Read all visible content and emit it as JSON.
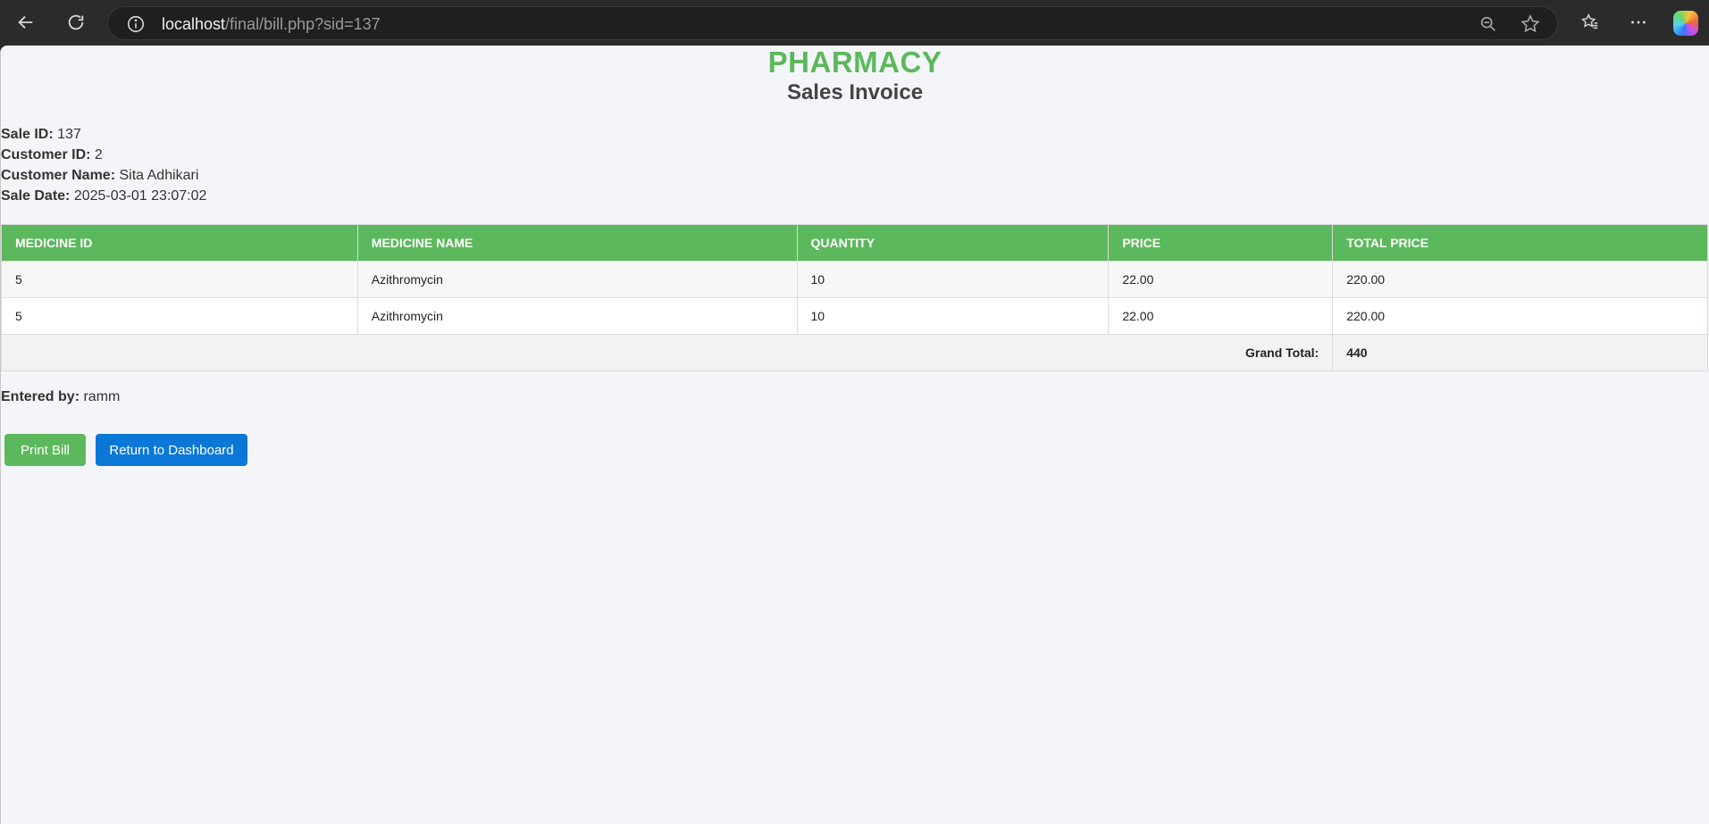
{
  "browser": {
    "url_host": "localhost",
    "url_path": "/final/bill.php?sid=137"
  },
  "page": {
    "brand": "PHARMACY",
    "subtitle": "Sales Invoice"
  },
  "details": {
    "sale_id_label": "Sale ID:",
    "sale_id": "137",
    "customer_id_label": "Customer ID:",
    "customer_id": "2",
    "customer_name_label": "Customer Name:",
    "customer_name": "Sita Adhikari",
    "sale_date_label": "Sale Date:",
    "sale_date": "2025-03-01 23:07:02"
  },
  "table": {
    "headers": [
      "MEDICINE ID",
      "MEDICINE NAME",
      "QUANTITY",
      "PRICE",
      "TOTAL PRICE"
    ],
    "rows": [
      [
        "5",
        "Azithromycin",
        "10",
        "22.00",
        "220.00"
      ],
      [
        "5",
        "Azithromycin",
        "10",
        "22.00",
        "220.00"
      ]
    ],
    "grand_total_label": "Grand Total:",
    "grand_total": "440"
  },
  "entered": {
    "label": "Entered by:",
    "value": "ramm"
  },
  "actions": {
    "print_label": "Print Bill",
    "dashboard_label": "Return to Dashboard"
  },
  "colors": {
    "brand_green": "#5cb85c",
    "primary_blue": "#0b78d7"
  }
}
